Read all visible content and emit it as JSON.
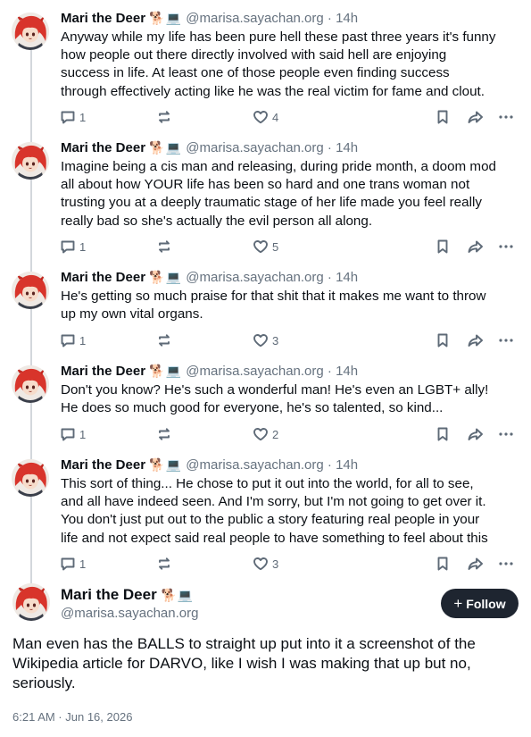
{
  "accent": "#1e2530",
  "author": {
    "name": "Mari the Deer",
    "emoji": "🐕💻",
    "handle": "@marisa.sayachan.org"
  },
  "posts": [
    {
      "time": "14h",
      "lines": [
        "Anyway while my life has been pure hell these past three years it's funny",
        "how people out there directly involved with said hell are enjoying",
        "success in life. At least one of those people even finding success",
        "through effectively acting like he was the real victim for fame and clout."
      ],
      "replies": "1",
      "likes": "4"
    },
    {
      "time": "14h",
      "lines": [
        "Imagine being a cis man and releasing, during pride month, a doom mod",
        "all about how YOUR life has been so hard and one trans woman not",
        "trusting you at a deeply traumatic stage of her life made you feel really",
        "really bad so she's actually the evil person all along."
      ],
      "replies": "1",
      "likes": "5"
    },
    {
      "time": "14h",
      "lines": [
        "He's getting so much praise for that shit that it makes me want to throw",
        "up my own vital organs."
      ],
      "replies": "1",
      "likes": "3"
    },
    {
      "time": "14h",
      "lines": [
        "Don't you know? He's such a wonderful man! He's even an LGBT+ ally!",
        "He does so much good for everyone, he's so talented, so kind..."
      ],
      "replies": "1",
      "likes": "2"
    },
    {
      "time": "14h",
      "lines": [
        "This sort of thing... He chose to put it out into the world, for all to see,",
        "and all have indeed seen. And I'm sorry, but I'm not going to get over it.",
        "You don't just put out to the public a story featuring real people in your",
        "life and not expect said real people to have something to feel about this"
      ],
      "replies": "1",
      "likes": "3"
    }
  ],
  "main": {
    "follow_label": "Follow",
    "lines": [
      "Man even has the BALLS to straight up put into it a screenshot of the",
      "Wikipedia article for DARVO, like I wish I was making that up but no,",
      "seriously."
    ],
    "date": "6:21 AM · Jun 16, 2026"
  }
}
